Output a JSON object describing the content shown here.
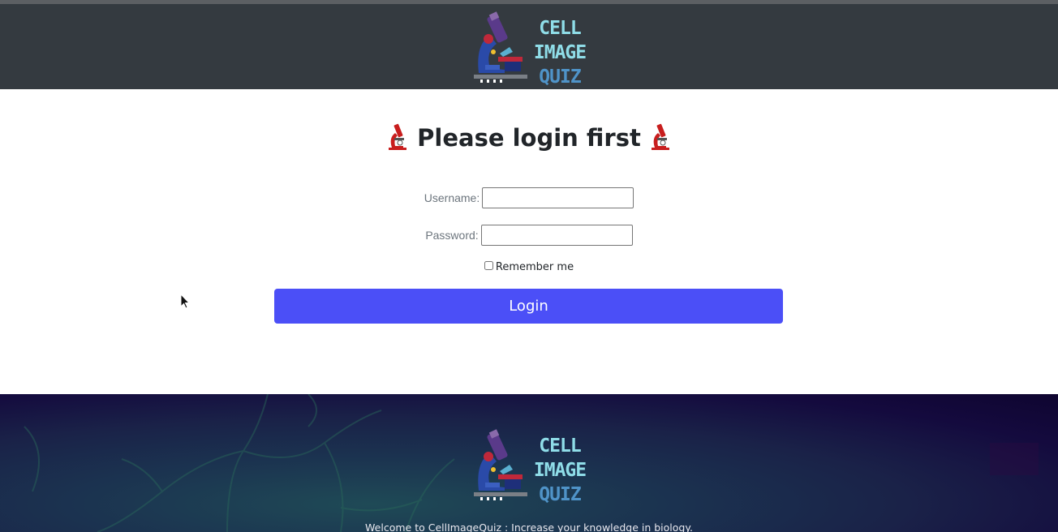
{
  "header": {
    "logo": {
      "icon": "microscope-icon",
      "text_lines": [
        "CELL",
        "IMAGE",
        "QUIZ"
      ]
    }
  },
  "login": {
    "title": "Please login first",
    "title_icon": "microscope-emoji-icon",
    "username_label": "Username:",
    "username_value": "",
    "password_label": "Password:",
    "password_value": "",
    "remember_label": "Remember me",
    "remember_checked": false,
    "submit_label": "Login"
  },
  "footer": {
    "logo": {
      "icon": "microscope-icon",
      "text_lines": [
        "CELL",
        "IMAGE",
        "QUIZ"
      ]
    },
    "welcome_text": "Welcome to CellImageQuiz : Increase your knowledge in biology."
  },
  "colors": {
    "header_bg": "#343a40",
    "button_bg": "#4b4ff7",
    "logo_text_light": "#8fdde8",
    "logo_text_dark": "#4f93c8",
    "footer_bg": "#1a2248"
  }
}
